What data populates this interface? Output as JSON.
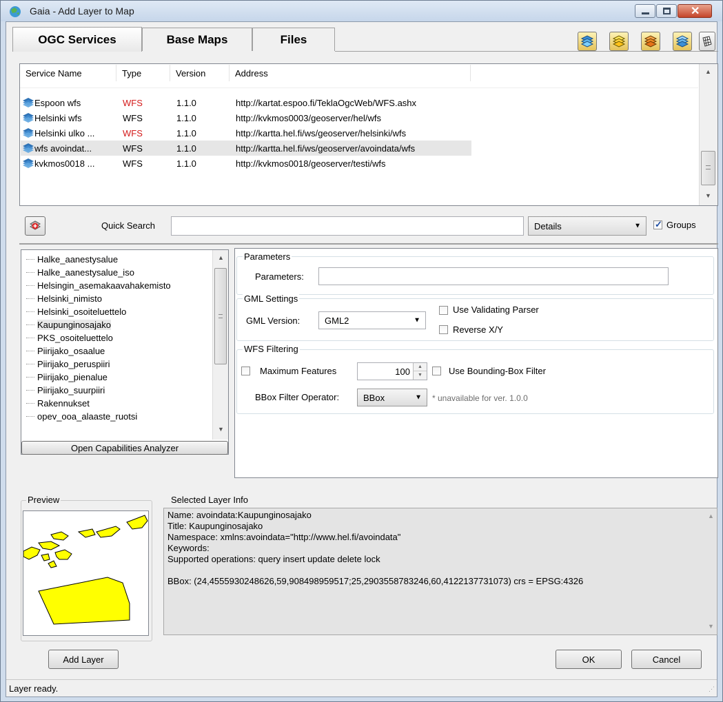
{
  "window": {
    "title": "Gaia - Add Layer to Map"
  },
  "tabs": [
    {
      "label": "OGC Services"
    },
    {
      "label": "Base Maps"
    },
    {
      "label": "Files"
    }
  ],
  "toolbar_icons": [
    "wms-layers-icon",
    "wfs-layers-icon",
    "wmts-layers-icon",
    "wcs-layers-icon",
    "other-layers-icon"
  ],
  "services": {
    "columns": [
      "Service Name",
      "Type",
      "Version",
      "Address"
    ],
    "rows": [
      {
        "name": "Espoon wfs",
        "type": "WFS",
        "type_color": "#d41b1b",
        "version": "1.1.0",
        "address": "http://kartat.espoo.fi/TeklaOgcWeb/WFS.ashx"
      },
      {
        "name": "Helsinki wfs",
        "type": "WFS",
        "type_color": "#000000",
        "version": "1.1.0",
        "address": "http://kvkmos0003/geoserver/hel/wfs"
      },
      {
        "name": "Helsinki ulko ...",
        "type": "WFS",
        "type_color": "#d41b1b",
        "version": "1.1.0",
        "address": "http://kartta.hel.fi/ws/geoserver/helsinki/wfs"
      },
      {
        "name": "wfs avoindat...",
        "type": "WFS",
        "type_color": "#000000",
        "version": "1.1.0",
        "address": "http://kartta.hel.fi/ws/geoserver/avoindata/wfs"
      },
      {
        "name": "kvkmos0018 ...",
        "type": "WFS",
        "type_color": "#000000",
        "version": "1.1.0",
        "address": "http://kvkmos0018/geoserver/testi/wfs"
      }
    ]
  },
  "search": {
    "label": "Quick Search",
    "value": "",
    "view_mode": "Details",
    "groups_label": "Groups",
    "groups_checked": true
  },
  "layers": {
    "items": [
      "Halke_aanestysalue",
      "Halke_aanestysalue_iso",
      "Helsingin_asemakaavahakemisto",
      "Helsinki_nimisto",
      "Helsinki_osoiteluettelo",
      "Kaupunginosajako",
      "PKS_osoiteluettelo",
      "Piirijako_osaalue",
      "Piirijako_peruspiiri",
      "Piirijako_pienalue",
      "Piirijako_suurpiiri",
      "Rakennukset",
      "opev_ooa_alaaste_ruotsi"
    ],
    "selected": "Kaupunginosajako",
    "analyzer_button": "Open Capabilities Analyzer"
  },
  "params": {
    "group_title": "Parameters",
    "label": "Parameters:",
    "value": ""
  },
  "gml": {
    "group_title": "GML Settings",
    "version_label": "GML Version:",
    "version_value": "GML2",
    "validating_label": "Use Validating Parser",
    "reverse_label": "Reverse X/Y"
  },
  "filtering": {
    "group_title": "WFS Filtering",
    "max_label": "Maximum Features",
    "max_value": "100",
    "bbox_filter_label": "Use Bounding-Box Filter",
    "operator_label": "BBox Filter Operator:",
    "operator_value": "BBox",
    "unavailable_note": "* unavailable for ver. 1.0.0"
  },
  "preview": {
    "label": "Preview"
  },
  "info": {
    "label": "Selected Layer Info",
    "name": "Name: avoindata:Kaupunginosajako",
    "title": "Title: Kaupunginosajako",
    "namespace": "Namespace: xmlns:avoindata=\"http://www.hel.fi/avoindata\"",
    "keywords": "Keywords:",
    "operations": "Supported operations: query insert update delete lock",
    "bbox": "BBox: (24,4555930248626,59,908498959517;25,2903558783246,60,4122137731073) crs = EPSG:4326"
  },
  "buttons": {
    "add_layer": "Add Layer",
    "ok": "OK",
    "cancel": "Cancel"
  },
  "status": {
    "text": "Layer ready."
  },
  "colors": {
    "selected_row": "#e6e6e6",
    "wfs_red": "#d41b1b",
    "preview_fill": "#ffff00"
  }
}
